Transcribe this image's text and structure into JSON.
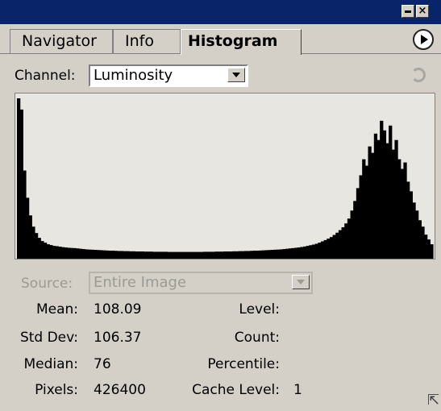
{
  "window": {
    "minimize_icon": "minimize-icon",
    "close_icon": "close-icon",
    "close_glyph": "×"
  },
  "tabs": [
    {
      "label": "Navigator",
      "active": false
    },
    {
      "label": "Info",
      "active": false
    },
    {
      "label": "Histogram",
      "active": true
    }
  ],
  "channel": {
    "label": "Channel:",
    "value": "Luminosity"
  },
  "source": {
    "label": "Source:",
    "value": "Entire Image"
  },
  "stats": {
    "mean_label": "Mean:",
    "mean": "108.09",
    "std_label": "Std Dev:",
    "std": "106.37",
    "median_label": "Median:",
    "median": "76",
    "pixels_label": "Pixels:",
    "pixels": "426400",
    "level_label": "Level:",
    "level": "",
    "count_label": "Count:",
    "count": "",
    "percentile_label": "Percentile:",
    "percentile": "",
    "cache_label": "Cache Level:",
    "cache": "1"
  },
  "histogram": {
    "color": "#000000",
    "background": "#e8e6e0",
    "values": [
      1.0,
      0.93,
      0.55,
      0.38,
      0.27,
      0.2,
      0.16,
      0.13,
      0.11,
      0.1,
      0.09,
      0.085,
      0.08,
      0.078,
      0.075,
      0.072,
      0.07,
      0.068,
      0.067,
      0.066,
      0.064,
      0.062,
      0.06,
      0.058,
      0.057,
      0.056,
      0.055,
      0.054,
      0.053,
      0.052,
      0.051,
      0.05,
      0.05,
      0.049,
      0.048,
      0.048,
      0.047,
      0.047,
      0.046,
      0.046,
      0.045,
      0.045,
      0.045,
      0.044,
      0.044,
      0.044,
      0.043,
      0.043,
      0.043,
      0.043,
      0.043,
      0.042,
      0.042,
      0.042,
      0.042,
      0.042,
      0.042,
      0.042,
      0.042,
      0.042,
      0.042,
      0.042,
      0.042,
      0.043,
      0.043,
      0.043,
      0.043,
      0.044,
      0.044,
      0.044,
      0.045,
      0.045,
      0.045,
      0.046,
      0.046,
      0.047,
      0.047,
      0.048,
      0.048,
      0.049,
      0.05,
      0.05,
      0.051,
      0.052,
      0.053,
      0.054,
      0.055,
      0.056,
      0.057,
      0.058,
      0.06,
      0.062,
      0.064,
      0.066,
      0.068,
      0.07,
      0.073,
      0.076,
      0.08,
      0.084,
      0.088,
      0.093,
      0.1,
      0.108,
      0.116,
      0.125,
      0.135,
      0.148,
      0.162,
      0.178,
      0.196,
      0.22,
      0.25,
      0.3,
      0.36,
      0.44,
      0.52,
      0.62,
      0.58,
      0.7,
      0.66,
      0.78,
      0.74,
      0.86,
      0.8,
      0.72,
      0.83,
      0.68,
      0.74,
      0.62,
      0.56,
      0.6,
      0.48,
      0.42,
      0.35,
      0.3,
      0.24,
      0.2,
      0.15,
      0.12,
      0.09
    ]
  }
}
